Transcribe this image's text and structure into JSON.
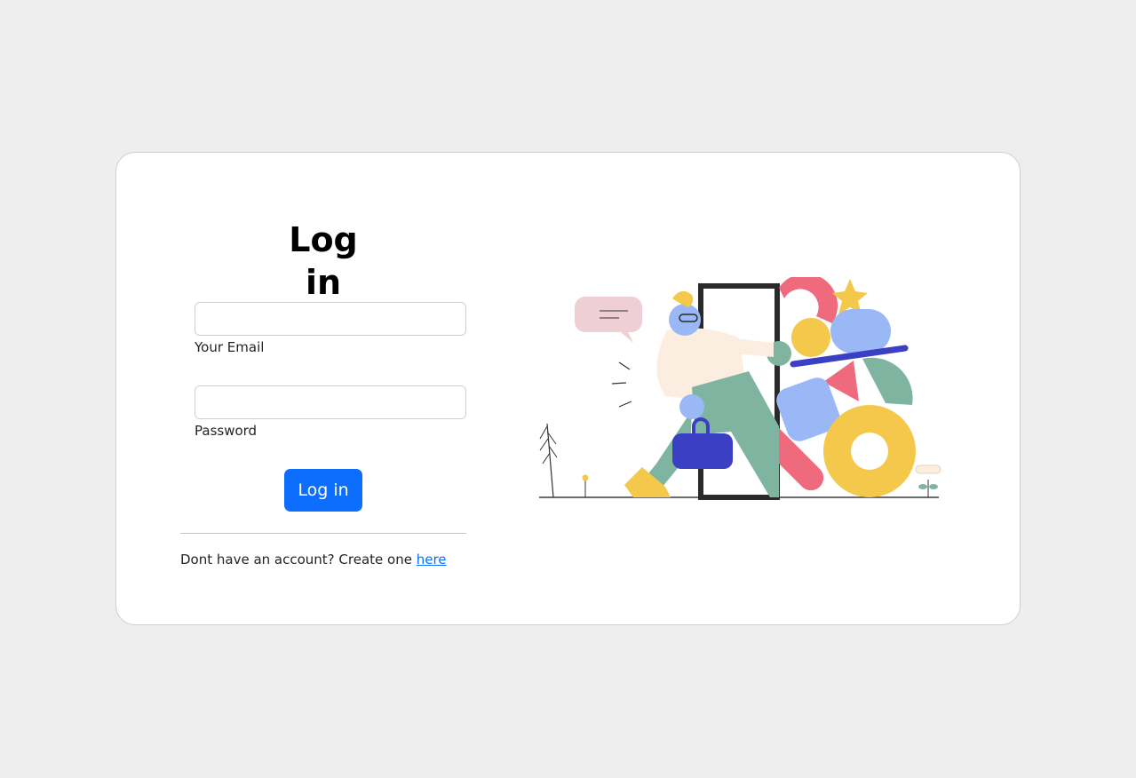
{
  "login": {
    "title": "Log in",
    "email_label": "Your Email",
    "email_value": "",
    "password_label": "Password",
    "password_value": "",
    "submit_label": "Log in",
    "signup_prompt": "Dont have an account? Create one ",
    "signup_link": "here"
  },
  "colors": {
    "page_background": "#eeeeee",
    "card_background": "#ffffff",
    "primary_button": "#0d6efd",
    "link": "#0d6efd"
  },
  "illustration": {
    "icon": "person-door-shapes-illustration"
  }
}
